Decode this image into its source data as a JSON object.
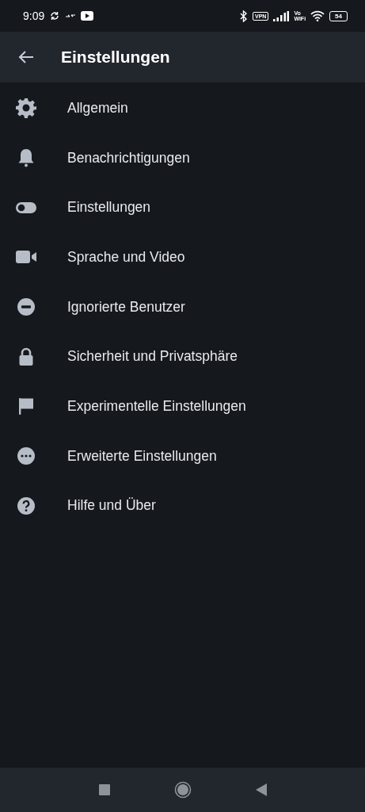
{
  "status_bar": {
    "time": "9:09",
    "vpn": "VPN",
    "volte": "Vo",
    "wifi_label": "WiFi",
    "battery": "54"
  },
  "app_bar": {
    "title": "Einstellungen"
  },
  "items": [
    {
      "label": "Allgemein",
      "kind": "gear"
    },
    {
      "label": "Benachrichtigungen",
      "kind": "bell"
    },
    {
      "label": "Einstellungen",
      "kind": "toggle"
    },
    {
      "label": "Sprache und Video",
      "kind": "video"
    },
    {
      "label": "Ignorierte Benutzer",
      "kind": "minus"
    },
    {
      "label": "Sicherheit und Privatsphäre",
      "kind": "lock"
    },
    {
      "label": "Experimentelle Einstellungen",
      "kind": "flag"
    },
    {
      "label": "Erweiterte Einstellungen",
      "kind": "dots"
    },
    {
      "label": "Hilfe und Über",
      "kind": "help"
    }
  ]
}
